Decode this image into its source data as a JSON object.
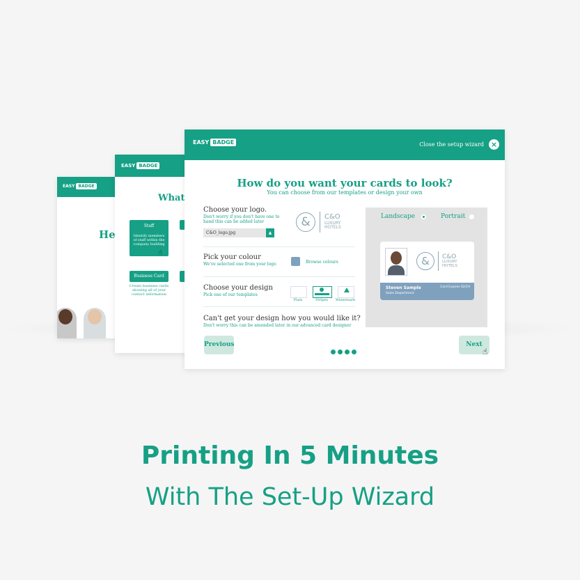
{
  "colors": {
    "accent": "#16a085",
    "card_band": "#7fa1bd",
    "light_button": "#cfe8df"
  },
  "logo": {
    "easy": "EASY",
    "badge": "BADGE"
  },
  "back_window_1": {
    "heading": "He"
  },
  "back_window_2": {
    "heading": "What",
    "staff_label": "Staff",
    "staff_desc": "Identify members of staff within the company building",
    "business_label": "Business Card",
    "business_desc": "Create business cards showing all of your contact information"
  },
  "wizard": {
    "close_label": "Close the setup wizard",
    "close_icon": "close-icon",
    "title": "How do you want your cards to look?",
    "subtitle": "You can choose from our templates or design your own",
    "logo_section": {
      "title": "Choose your logo.",
      "sub": "Don't worry if you don't have one to hand this can be added later",
      "file_name": "C&O_logo.jpg"
    },
    "colour_section": {
      "title": "Pick your colour",
      "sub": "We've selected one from your logo",
      "browse": "Browse colours"
    },
    "design_section": {
      "title": "Choose your design",
      "sub": "Pick one of our templates",
      "templates": [
        "Plain",
        "Stripes",
        "Watermark"
      ],
      "selected": "Stripes"
    },
    "custom_section": {
      "title": "Can't get your design how you would like it?",
      "sub": "Don't worry this can be amended later in our advanced card designer"
    },
    "brand": {
      "mark": "&",
      "name": "C&O",
      "line2": "LUXURY",
      "line3": "HOTELS"
    },
    "orientation": {
      "landscape": "Landscape",
      "portrait": "Portrait",
      "selected": "Landscape"
    },
    "card": {
      "name": "Steven Sample",
      "department": "Sales Department",
      "expiry": "Card Expires 02/19"
    },
    "previous_label": "Previous",
    "next_label": "Next",
    "steps": 4
  },
  "headline": "Printing In 5 Minutes",
  "subline": "With The Set-Up Wizard"
}
